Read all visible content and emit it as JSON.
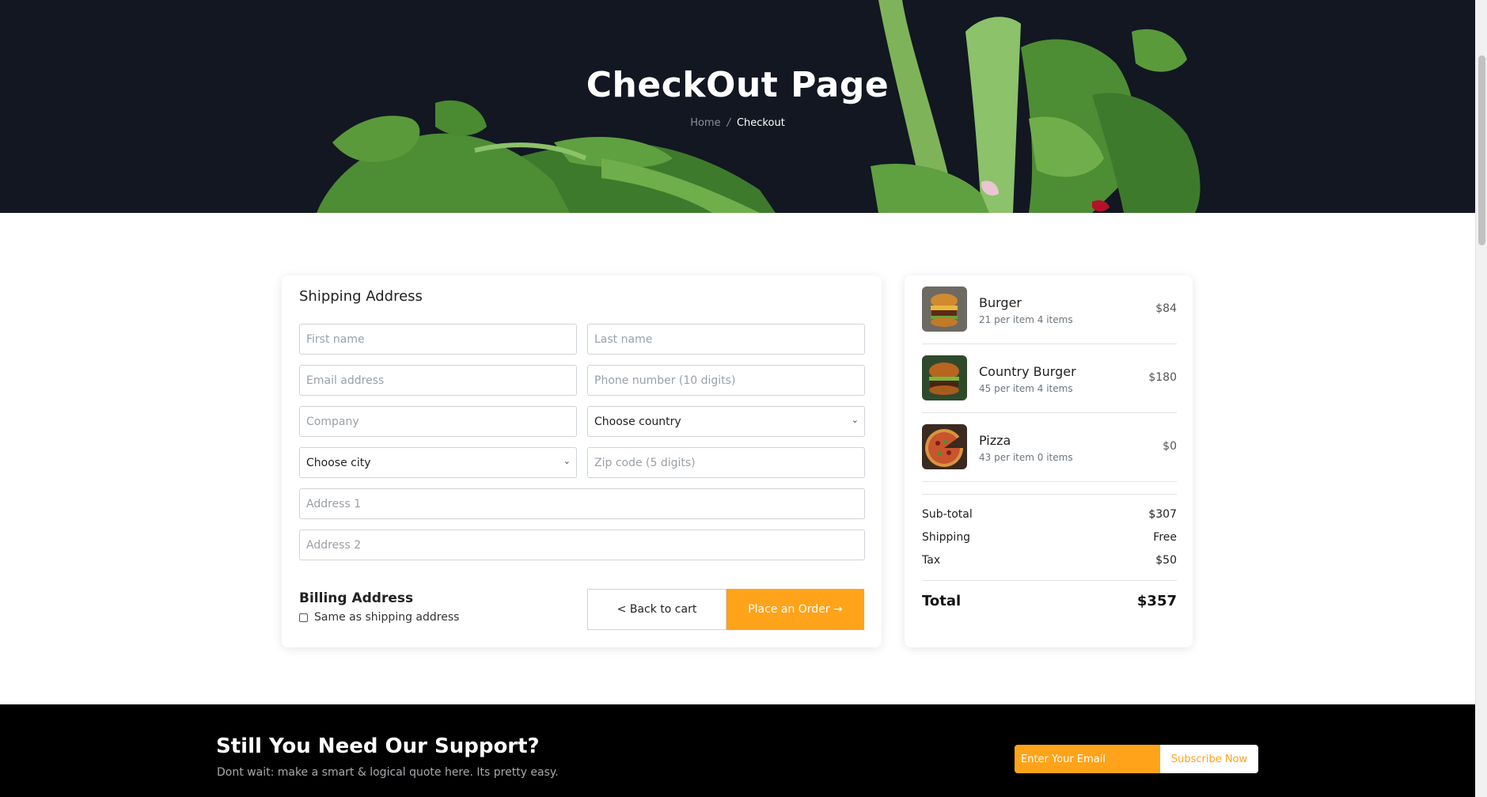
{
  "hero": {
    "title": "CheckOut Page",
    "breadcrumb": {
      "home": "Home",
      "separator": "/",
      "current": "Checkout"
    }
  },
  "shipping": {
    "title": "Shipping Address",
    "first_name_placeholder": "First name",
    "last_name_placeholder": "Last name",
    "email_placeholder": "Email address",
    "phone_placeholder": "Phone number (10 digits)",
    "company_placeholder": "Company",
    "country_selected": "Choose country",
    "city_selected": "Choose city",
    "zip_placeholder": "Zip code (5 digits)",
    "address1_placeholder": "Address 1",
    "address2_placeholder": "Address 2"
  },
  "billing": {
    "title": "Billing Address",
    "same_as_label": "Same as shipping address",
    "same_as_checked": false
  },
  "actions": {
    "back_label": "< Back to cart",
    "order_label": "Place an Order →"
  },
  "order": {
    "items": [
      {
        "name": "Burger",
        "meta": "21 per item 4 items",
        "price": "$84",
        "image": "burger-image"
      },
      {
        "name": "Country Burger",
        "meta": "45 per item 4 items",
        "price": "$180",
        "image": "country-burger-image"
      },
      {
        "name": "Pizza",
        "meta": "43 per item 0 items",
        "price": "$0",
        "image": "pizza-image"
      }
    ],
    "subtotal_label": "Sub-total",
    "subtotal_value": "$307",
    "shipping_label": "Shipping",
    "shipping_value": "Free",
    "tax_label": "Tax",
    "tax_value": "$50",
    "total_label": "Total",
    "total_value": "$357"
  },
  "support": {
    "title": "Still You Need Our Support?",
    "subtitle": "Dont wait: make a smart & logical quote here. Its pretty easy.",
    "email_placeholder": "Enter Your Email",
    "subscribe_label": "Subscribe Now"
  },
  "colors": {
    "accent": "#ffa31a",
    "hero_bg": "#121722",
    "footer_bg": "#000000"
  }
}
